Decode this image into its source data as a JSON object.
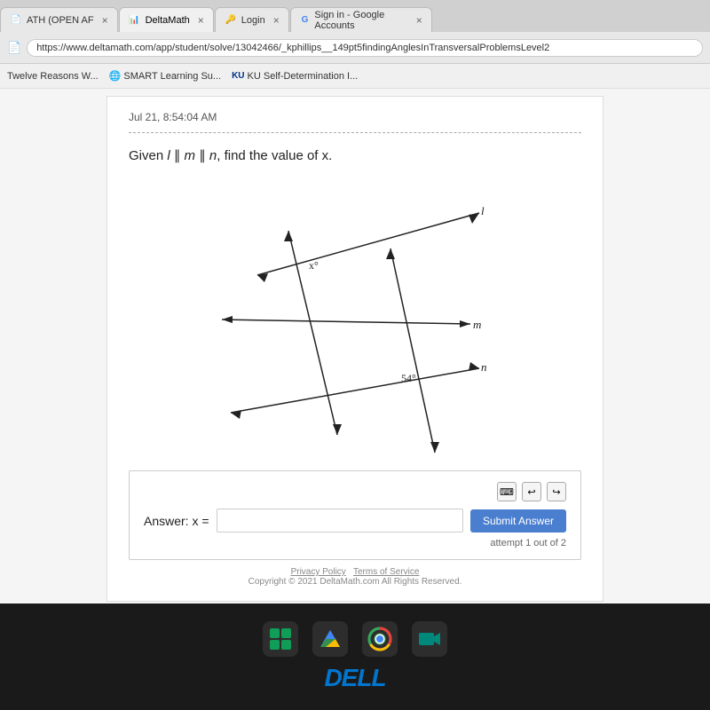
{
  "browser": {
    "tabs": [
      {
        "id": "tab1",
        "label": "ATH (OPEN AF",
        "favicon": "📄",
        "active": false
      },
      {
        "id": "tab2",
        "label": "DeltaMath",
        "favicon": "📊",
        "active": true
      },
      {
        "id": "tab3",
        "label": "Login",
        "favicon": "🔑",
        "active": false
      },
      {
        "id": "tab4",
        "label": "Sign in - Google Accounts",
        "favicon": "G",
        "active": false
      }
    ],
    "address": "https://www.deltamath.com/app/student/solve/13042466/_kphillips__149pt5findingAnglesInTransversalProblemsLevel2"
  },
  "bookmarks": [
    {
      "label": "Twelve Reasons W..."
    },
    {
      "label": "SMART Learning Su..."
    },
    {
      "label": "KU Self-Determination I..."
    }
  ],
  "page": {
    "timestamp": "Jul 21, 8:54:04 AM",
    "problem_text": "Given l ∥ m ∥ n, find the value of x.",
    "angle_x_label": "x°",
    "angle_54_label": "54°",
    "line_l": "l",
    "line_m": "m",
    "line_n": "n",
    "answer_label": "Answer:  x =",
    "submit_label": "Submit Answer",
    "attempt_text": "attempt 1 out of 2",
    "footer_privacy": "Privacy Policy",
    "footer_terms": "Terms of Service",
    "footer_copyright": "Copyright © 2021 DeltaMath.com All Rights Reserved."
  },
  "taskbar": {
    "dell_label": "DELL"
  }
}
